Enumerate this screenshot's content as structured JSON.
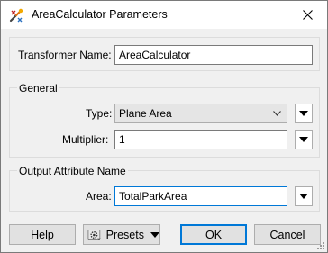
{
  "window": {
    "title": "AreaCalculator Parameters"
  },
  "transformer": {
    "label": "Transformer Name:",
    "value": "AreaCalculator"
  },
  "general": {
    "group_label": "General",
    "type_label": "Type:",
    "type_value": "Plane Area",
    "multiplier_label": "Multiplier:",
    "multiplier_value": "1"
  },
  "output": {
    "group_label": "Output Attribute Name",
    "area_label": "Area:",
    "area_value": "TotalParkArea"
  },
  "buttons": {
    "help": "Help",
    "presets": "Presets",
    "ok": "OK",
    "cancel": "Cancel"
  },
  "colors": {
    "focus_border": "#0078d7",
    "background": "#f0f0f0"
  }
}
